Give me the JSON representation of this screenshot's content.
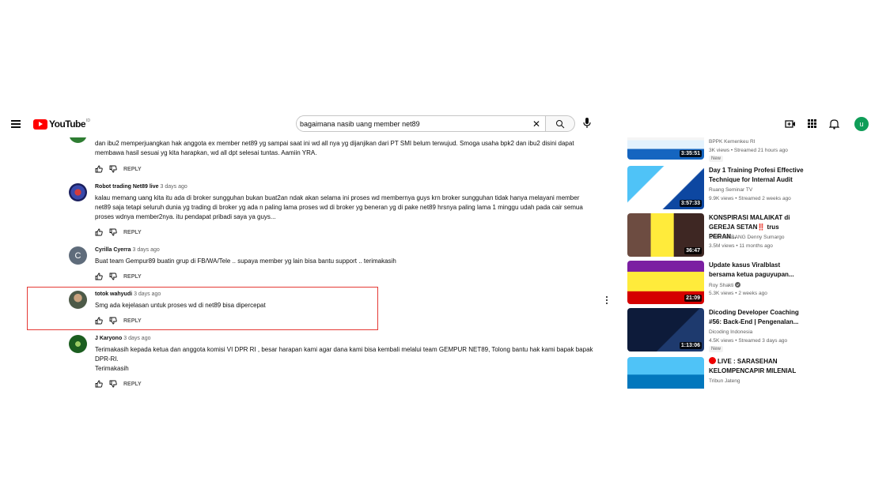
{
  "header": {
    "logo_text": "YouTube",
    "logo_suffix": "ID",
    "search_value": "bagaimana nasib uang member net89",
    "avatar_letter": "u"
  },
  "colors": {
    "brand_red": "#ff0000",
    "highlight_border": "#e53935",
    "avatar_green": "#0f9d58"
  },
  "comments": [
    {
      "author": "",
      "time": "",
      "text": "dan  ibu2 memperjuangkan hak anggota ex member net89 yg sampai saat ini wd all nya yg dijanjikan dari PT SMI belum terwujud. Smoga usaha bpk2 dan ibu2 disini dapat membawa hasil sesuai yg kita harapkan, wd all dpt selesai tuntas. Aamiin YRA.",
      "reply": "REPLY"
    },
    {
      "author": "Robot trading Net89 live",
      "time": "3 days ago",
      "text": "kalau memang uang kita itu ada di broker sungguhan bukan buat2an ndak akan selama ini proses wd membernya guys krn broker sungguhan tidak hanya melayani member net89 saja tetapi seluruh dunia yg trading di broker yg ada n paling lama proses wd di broker yg beneran yg di pake net89 hrsnya paling lama 1 minggu udah pada cair semua proses wdnya member2nya. itu pendapat pribadi saya ya guys...",
      "reply": "REPLY"
    },
    {
      "author": "Cyrilla Cyerra",
      "time": "3 days ago",
      "avatar_letter": "C",
      "text": "Buat team Gempur89 buatin grup di FB/WA/Tele .. supaya member yg lain bisa bantu support .. terimakasih",
      "reply": "REPLY"
    },
    {
      "author": "totok wahyudi",
      "time": "3 days ago",
      "text": "Smg ada kejelasan untuk proses wd di net89 bisa dipercepat",
      "reply": "REPLY"
    },
    {
      "author": "J Karyono",
      "time": "3 days ago",
      "text": "Terimakasih kepada ketua dan anggota komisi VI DPR RI , besar harapan kami agar dana kami bisa kembali melalui team GEMPUR NET89, Tolong bantu hak kami bapak bapak DPR-RI.",
      "text2": "Terimakasih",
      "reply": "REPLY"
    }
  ],
  "videos": [
    {
      "title": "",
      "channel": "BPPK Kemenkeu RI",
      "stats": "3K views • Streamed 21 hours ago",
      "badge": "New",
      "duration": "3:35:51"
    },
    {
      "title": "Day 1 Training Profesi Effective Technique for Internal Audit",
      "channel": "Ruang Seminar TV",
      "stats": "9.9K views • Streamed 2 weeks ago",
      "duration": "3:57:33"
    },
    {
      "title": "KONSPIRASI MALAIKAT di GEREJA SETAN‼️ trus PERAN...",
      "channel": "CURHAT BANG Denny Sumargo",
      "stats": "3.5M views • 11 months ago",
      "duration": "36:47"
    },
    {
      "title": "Update kasus Viralblast bersama ketua paguyupan...",
      "channel": "Roy Shakti",
      "stats": "5.3K views • 2 weeks ago",
      "duration": "21:09"
    },
    {
      "title": "Dicoding Developer Coaching #56: Back-End | Pengenalan...",
      "channel": "Dicoding Indonesia",
      "stats": "4.5K views • Streamed 3 days ago",
      "badge": "New",
      "duration": "1:13:06"
    },
    {
      "title": "LIVE : SARASEHAN KELOMPENCAPIR MILENIAL",
      "channel": "Tribun Jateng",
      "stats": "",
      "duration": ""
    }
  ]
}
